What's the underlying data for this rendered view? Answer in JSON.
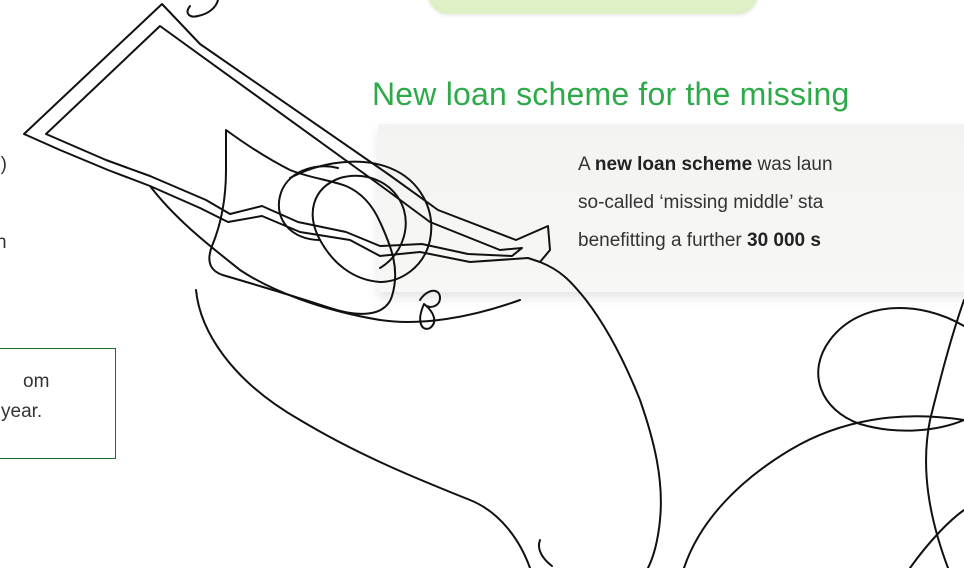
{
  "left_column": {
    "fragment_1": "S)",
    "fragment_2": "n",
    "callout": {
      "line_1": "om",
      "line_2": "year."
    }
  },
  "section": {
    "heading": "New loan scheme for the missing",
    "card": {
      "line_1": {
        "pre": "A ",
        "bold": "new loan scheme",
        "post": " was laun"
      },
      "line_2": {
        "text": "so-called ‘missing middle’ sta"
      },
      "line_3": {
        "pre": "benefitting a further ",
        "bold": "30 000 s"
      }
    }
  },
  "colors": {
    "heading_green": "#2eaa4a",
    "callout_border": "#1f6b2a",
    "top_tab": "#dff0c6",
    "card_bg": "#f3f3f1"
  }
}
